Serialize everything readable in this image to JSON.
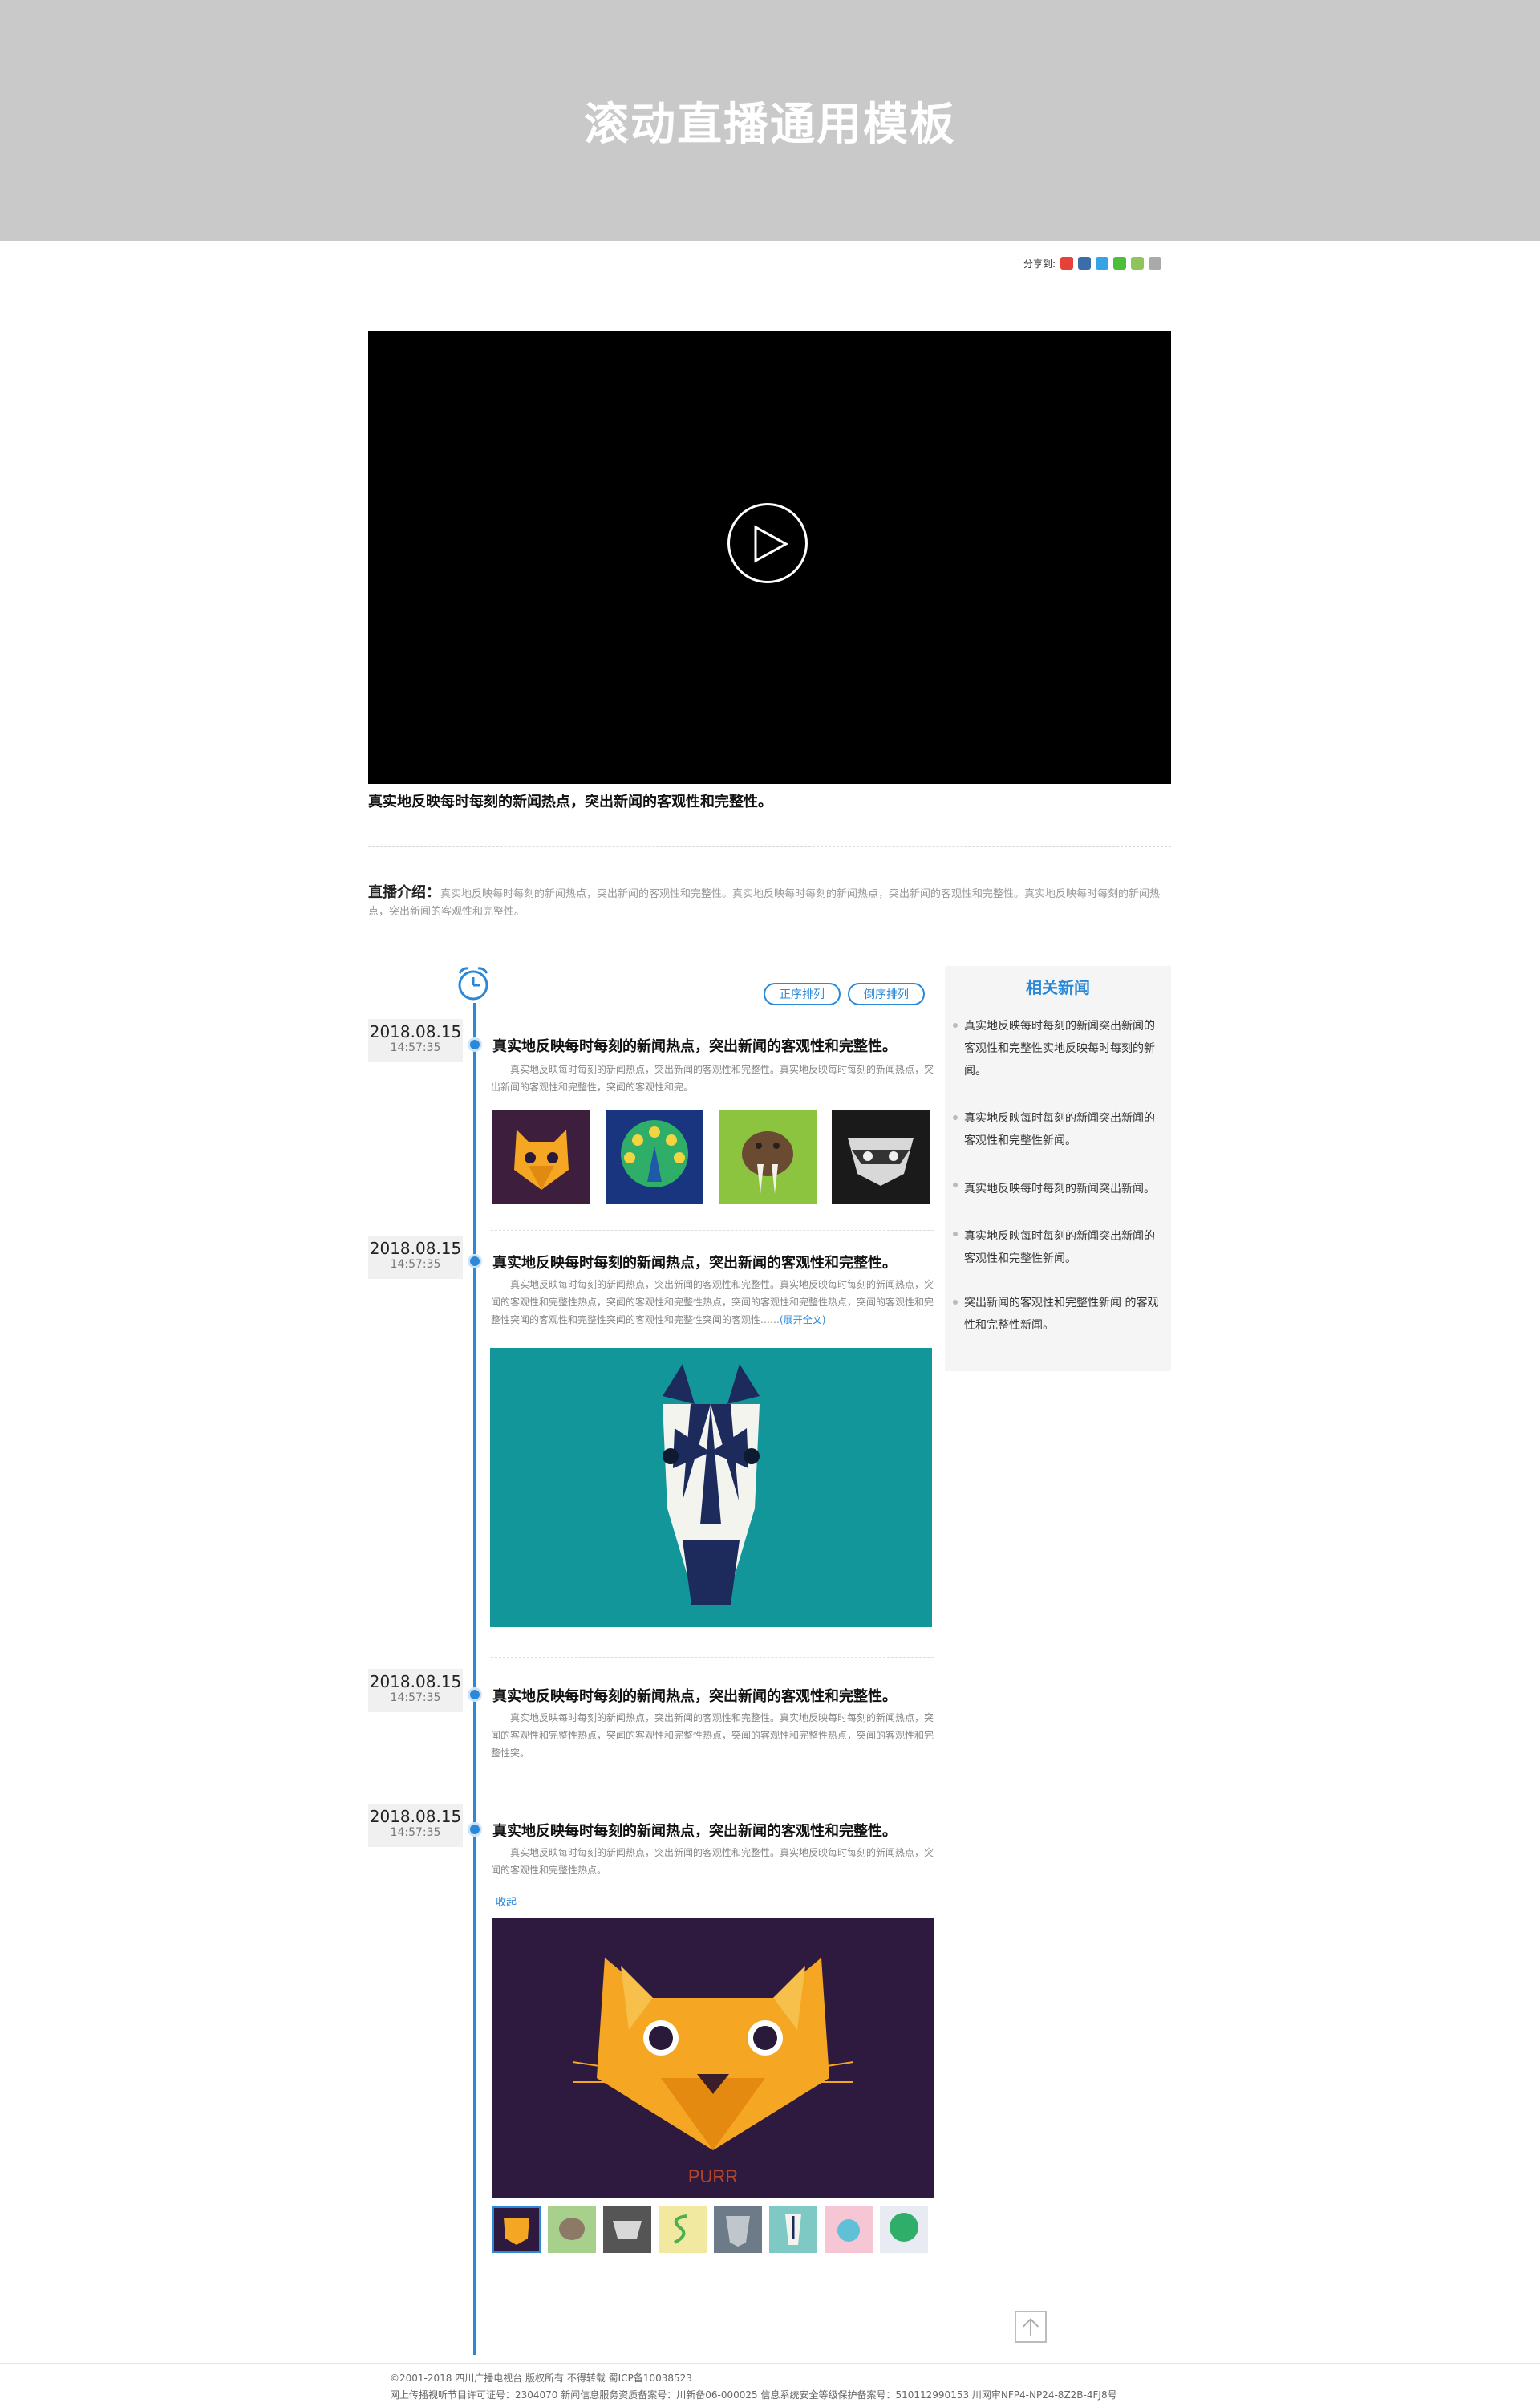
{
  "header": {
    "title": "滚动直播通用模板"
  },
  "share": {
    "label": "分享到:"
  },
  "video": {
    "caption": "真实地反映每时每刻的新闻热点，突出新闻的客观性和完整性。"
  },
  "intro": {
    "label": "直播介绍：",
    "text": "真实地反映每时每刻的新闻热点，突出新闻的客观性和完整性。真实地反映每时每刻的新闻热点，突出新闻的客观性和完整性。真实地反映每时每刻的新闻热点，突出新闻的客观性和完整性。"
  },
  "timeline": {
    "sort_asc": "正序排列",
    "sort_desc": "倒序排列",
    "items": [
      {
        "date": "2018.08.15",
        "time": "14:57:35",
        "title": "真实地反映每时每刻的新闻热点，突出新闻的客观性和完整性。",
        "text": "真实地反映每时每刻的新闻热点，突出新闻的客观性和完整性。真实地反映每时每刻的新闻热点，突出新闻的客观性和完整性，突闻的客观性和完。"
      },
      {
        "date": "2018.08.15",
        "time": "14:57:35",
        "title": "真实地反映每时每刻的新闻热点，突出新闻的客观性和完整性。",
        "text": "真实地反映每时每刻的新闻热点，突出新闻的客观性和完整性。真实地反映每时每刻的新闻热点，突闻的客观性和完整性热点，突闻的客观性和完整性热点，突闻的客观性和完整性热点，突闻的客观性和完整性突闻的客观性和完整性突闻的客观性和完整性突闻的客观性……",
        "expand": "(展开全文)"
      },
      {
        "date": "2018.08.15",
        "time": "14:57:35",
        "title": "真实地反映每时每刻的新闻热点，突出新闻的客观性和完整性。",
        "text": "真实地反映每时每刻的新闻热点，突出新闻的客观性和完整性。真实地反映每时每刻的新闻热点，突闻的客观性和完整性热点，突闻的客观性和完整性热点，突闻的客观性和完整性热点，突闻的客观性和完整性突。"
      },
      {
        "date": "2018.08.15",
        "time": "14:57:35",
        "title": "真实地反映每时每刻的新闻热点，突出新闻的客观性和完整性。",
        "text": "真实地反映每时每刻的新闻热点，突出新闻的客观性和完整性。真实地反映每时每刻的新闻热点，突闻的客观性和完整性热点。",
        "collapse": "收起",
        "poster_text": "PURR"
      }
    ]
  },
  "related": {
    "title": "相关新闻",
    "items": [
      "真实地反映每时每刻的新闻突出新闻的客观性和完整性实地反映每时每刻的新闻。",
      "真实地反映每时每刻的新闻突出新闻的客观性和完整性新闻。",
      "真实地反映每时每刻的新闻突出新闻。",
      "真实地反映每时每刻的新闻突出新闻的客观性和完整性新闻。",
      "突出新闻的客观性和完整性新闻 的客观性和完整性新闻。"
    ]
  },
  "footer": {
    "line1": "©2001-2018 四川广播电视台 版权所有 不得转载  蜀ICP备10038523",
    "line2": "网上传播视听节目许可证号：2304070   新闻信息服务资质备案号：川新备06-000025   信息系统安全等级保护备案号：510112990153   川网审NFP4-NP24-8Z2B-4FJ8号"
  },
  "colors": {
    "accent": "#2b88d8",
    "header_bg": "#c9c9c9"
  }
}
